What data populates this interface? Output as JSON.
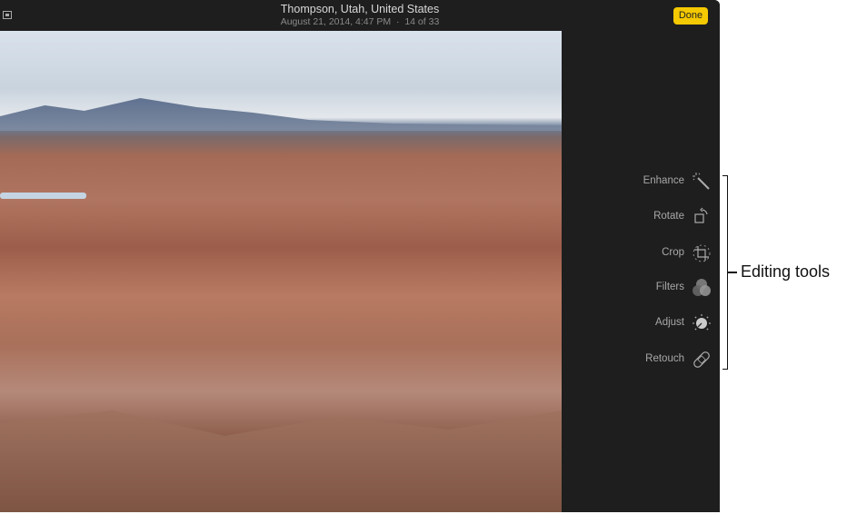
{
  "titlebar": {
    "title": "Thompson, Utah, United States",
    "date": "August 21, 2014, 4:47 PM",
    "separator": "·",
    "count": "14 of 33",
    "done_label": "Done"
  },
  "tools": [
    {
      "label": "Enhance",
      "icon": "magic-wand-icon"
    },
    {
      "label": "Rotate",
      "icon": "rotate-icon"
    },
    {
      "label": "Crop",
      "icon": "crop-icon"
    },
    {
      "label": "Filters",
      "icon": "filters-icon"
    },
    {
      "label": "Adjust",
      "icon": "adjust-dial-icon"
    },
    {
      "label": "Retouch",
      "icon": "bandage-icon"
    }
  ],
  "callout": {
    "label": "Editing tools"
  },
  "colors": {
    "accent": "#f5c900",
    "window": "#1e1e1e"
  }
}
